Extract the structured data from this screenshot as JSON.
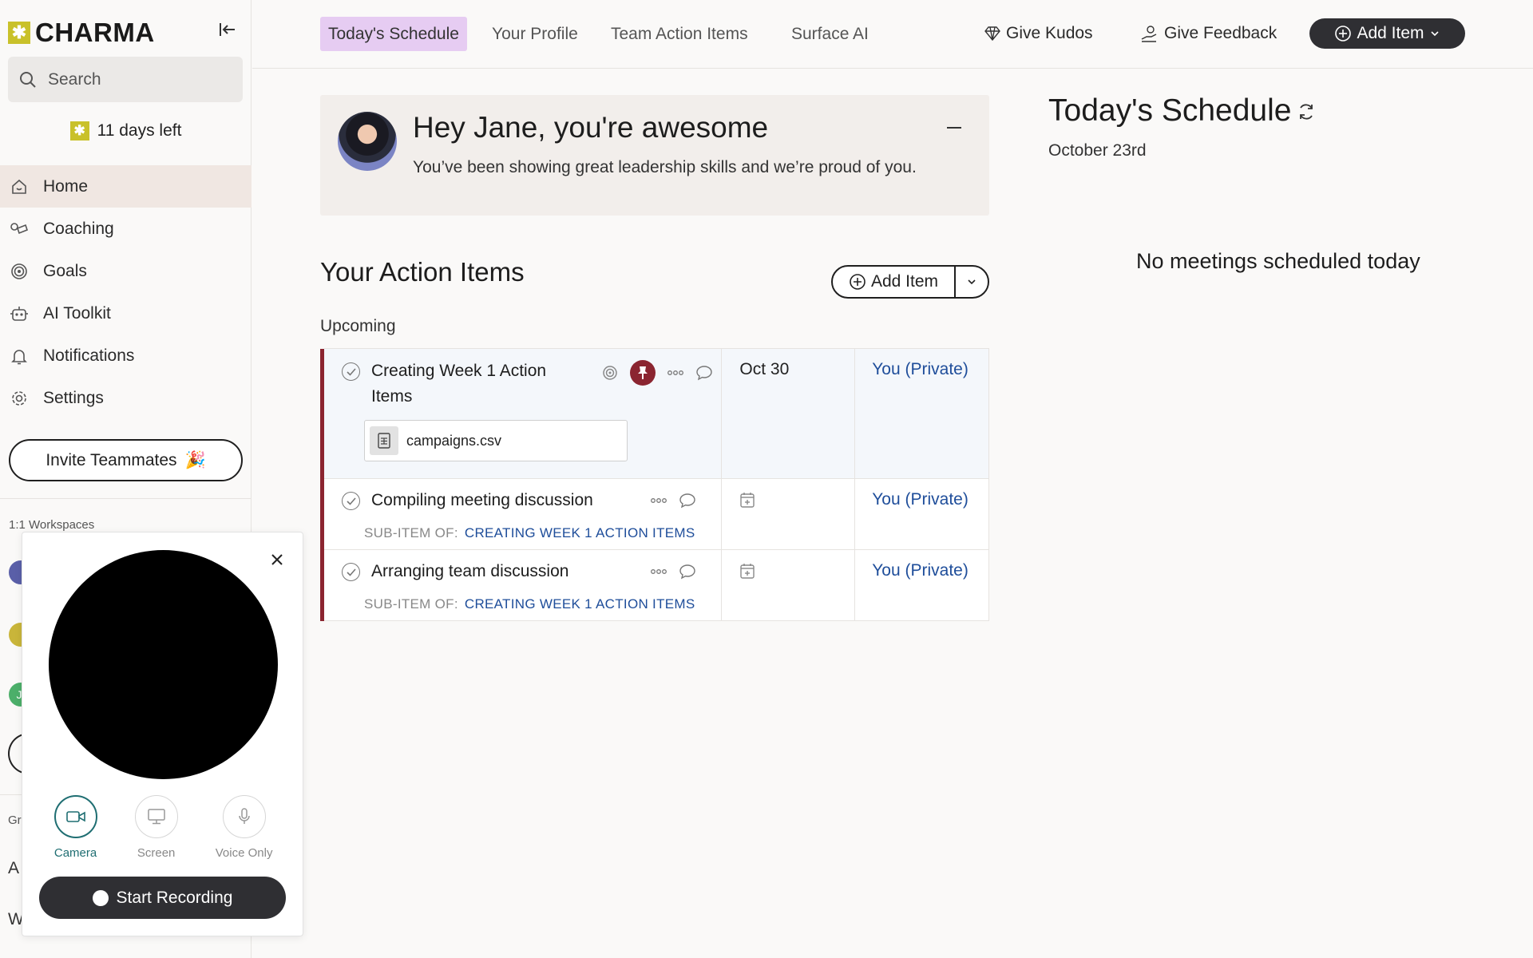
{
  "sidebar": {
    "brand": "CHARMA",
    "search_placeholder": "Search",
    "trial": "11 days left",
    "nav": [
      {
        "label": "Home",
        "icon": "home-icon"
      },
      {
        "label": "Coaching",
        "icon": "coaching-icon"
      },
      {
        "label": "Goals",
        "icon": "target-icon"
      },
      {
        "label": "AI Toolkit",
        "icon": "robot-icon"
      },
      {
        "label": "Notifications",
        "icon": "bell-icon"
      },
      {
        "label": "Settings",
        "icon": "gear-icon"
      }
    ],
    "invite_label": "Invite Teammates",
    "invite_emoji": "🎉",
    "workspaces_label": "1:1 Workspaces",
    "partial_labels": [
      "Gr",
      "A",
      "W"
    ],
    "avatar_initial": "JI"
  },
  "topnav": {
    "tabs": [
      "Today's Schedule",
      "Your Profile",
      "Team Action Items",
      "Surface AI"
    ],
    "give_kudos": "Give Kudos",
    "give_feedback": "Give Feedback",
    "add_item": "Add Item"
  },
  "greeting": {
    "title": "Hey Jane, you're awesome",
    "subtitle": "You’ve been showing great leadership skills and we’re proud of you."
  },
  "action_items": {
    "title": "Your Action Items",
    "add_label": "Add Item",
    "section": "Upcoming",
    "sub_item_prefix": "SUB-ITEM OF:",
    "rows": [
      {
        "title_line1": "Creating Week 1 Action",
        "title_line2": "Items",
        "attachment": "campaigns.csv",
        "date": "Oct 30",
        "owner": "You (Private)"
      },
      {
        "title": "Compiling meeting discussion",
        "parent": "CREATING WEEK 1 ACTION ITEMS",
        "owner": "You (Private)"
      },
      {
        "title": "Arranging team discussion",
        "parent": "CREATING WEEK 1 ACTION ITEMS",
        "owner": "You (Private)"
      }
    ]
  },
  "schedule": {
    "title": "Today's Schedule",
    "date": "October 23rd",
    "empty": "No meetings scheduled today"
  },
  "recorder": {
    "modes": [
      {
        "label": "Camera",
        "icon": "camera-icon",
        "active": true
      },
      {
        "label": "Screen",
        "icon": "monitor-icon",
        "active": false
      },
      {
        "label": "Voice Only",
        "icon": "microphone-icon",
        "active": false
      }
    ],
    "start_label": "Start Recording"
  },
  "colors": {
    "brand": "#c9c12a",
    "accent_dark": "#2f2f33",
    "tab_active": "#e6ccf2",
    "priority_bar": "#8b2530",
    "link": "#1e4d9a",
    "mode_active": "#1f6e72"
  }
}
